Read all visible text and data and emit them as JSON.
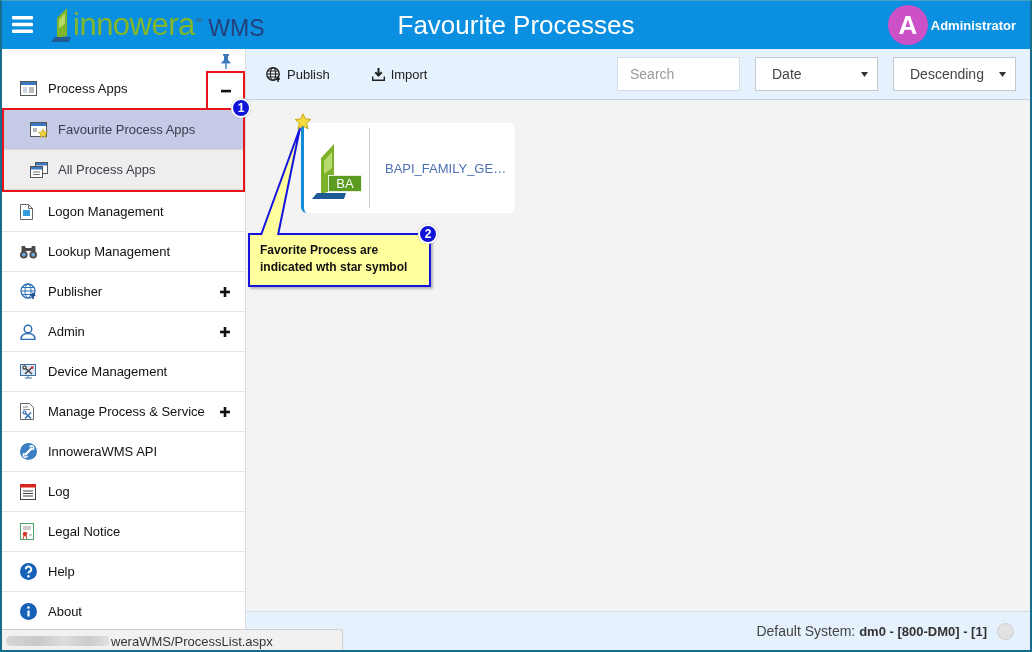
{
  "header": {
    "logo": {
      "name": "innowera$^{™}$",
      "suffix": "WMS"
    },
    "title": "Favourite Processes",
    "user": {
      "initial": "A",
      "name": "Administrator"
    }
  },
  "sidebar": {
    "items": [
      {
        "label": "Process Apps",
        "selected": false,
        "expanded": true,
        "children": [
          {
            "label": "Favourite Process Apps",
            "selected": true
          },
          {
            "label": "All Process Apps",
            "selected": false
          }
        ]
      },
      {
        "label": "Logon Management",
        "selected": false
      },
      {
        "label": "Lookup Management",
        "selected": false
      },
      {
        "label": "Publisher",
        "selected": false,
        "expanded": false
      },
      {
        "label": "Admin",
        "selected": false,
        "expanded": false
      },
      {
        "label": "Device Management",
        "selected": false
      },
      {
        "label": "Manage Process & Service",
        "selected": false,
        "expanded": false
      },
      {
        "label": "InnoweraWMS API",
        "selected": false
      },
      {
        "label": "Log",
        "selected": false
      },
      {
        "label": "Legal Notice",
        "selected": false
      },
      {
        "label": "Help",
        "selected": false
      },
      {
        "label": "About",
        "selected": false
      }
    ]
  },
  "toolbar": {
    "actions": [
      {
        "label": "Publish"
      },
      {
        "label": "Import"
      }
    ],
    "search": {
      "placeholder": "Search"
    },
    "sort_field": {
      "value": "Date"
    },
    "sort_order": {
      "value": "Descending"
    }
  },
  "processes": [
    {
      "title": "BAPI_FAMILY_GE…",
      "badge": "BA",
      "favourite": true
    }
  ],
  "annotations": {
    "markers": [
      {
        "number": "1"
      },
      {
        "number": "2"
      }
    ],
    "callout": {
      "text": "Favorite Process are indicated wth star symbol"
    }
  },
  "status_bar": {
    "text": "Default System: **dm0 - [800-DM0] - [1]**"
  },
  "link_preview": {
    "url": "weraWMS/ProcessList.aspx"
  }
}
